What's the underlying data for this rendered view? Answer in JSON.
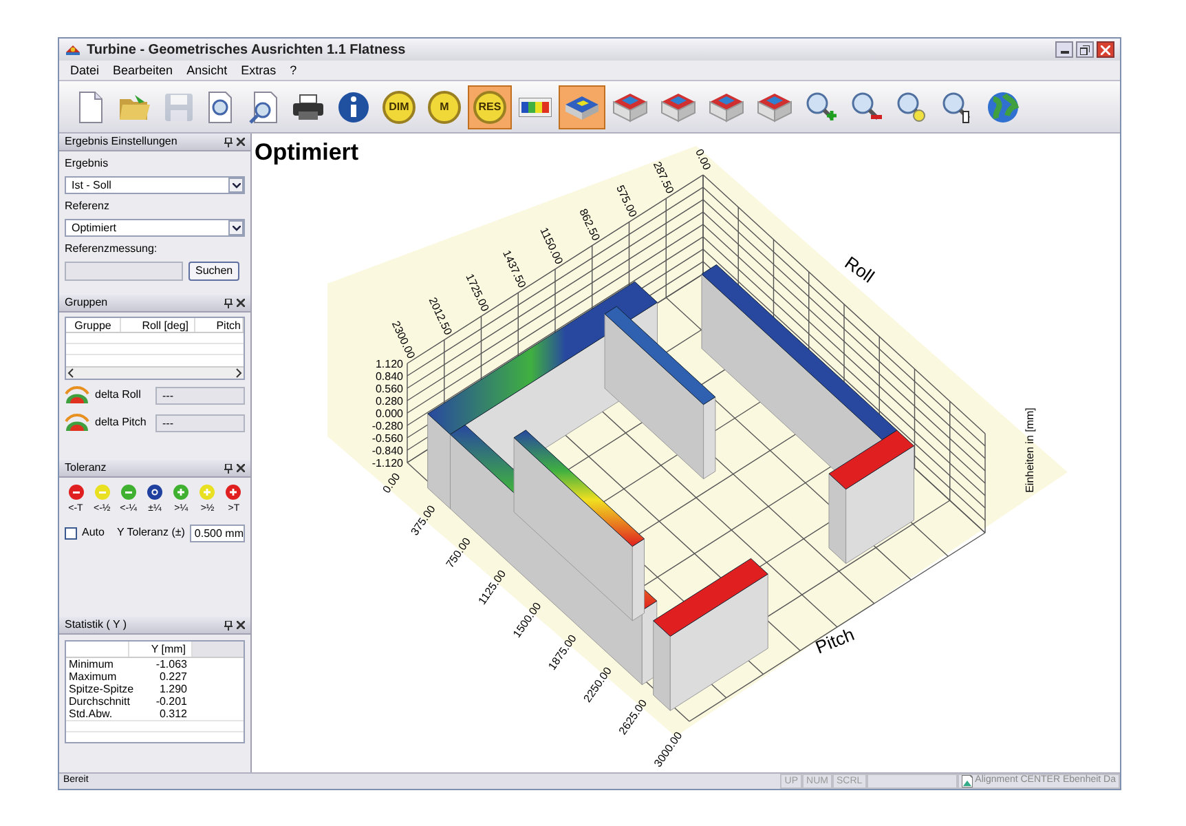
{
  "window": {
    "title": "Turbine - Geometrisches Ausrichten 1.1  Flatness"
  },
  "menu": [
    "Datei",
    "Bearbeiten",
    "Ansicht",
    "Extras",
    "?"
  ],
  "toolbar": [
    {
      "kind": "document",
      "selected": false,
      "disabled": false
    },
    {
      "kind": "folder",
      "selected": false,
      "disabled": false
    },
    {
      "kind": "save",
      "selected": false,
      "disabled": true
    },
    {
      "kind": "preview",
      "selected": false,
      "disabled": false
    },
    {
      "kind": "preview-zoom",
      "selected": false,
      "disabled": false
    },
    {
      "kind": "printer",
      "selected": false,
      "disabled": false
    },
    {
      "kind": "info",
      "selected": false,
      "disabled": false
    },
    {
      "kind": "badge",
      "label": "DIM",
      "selected": false,
      "disabled": false
    },
    {
      "kind": "badge",
      "label": "M",
      "selected": false,
      "disabled": false
    },
    {
      "kind": "badge",
      "label": "RES",
      "selected": true,
      "disabled": false
    },
    {
      "kind": "colorbar",
      "selected": false,
      "disabled": false
    },
    {
      "kind": "view3d",
      "selected": true,
      "disabled": false
    },
    {
      "kind": "box",
      "selected": false,
      "disabled": false
    },
    {
      "kind": "box",
      "selected": false,
      "disabled": false
    },
    {
      "kind": "box",
      "selected": false,
      "disabled": false
    },
    {
      "kind": "box",
      "selected": false,
      "disabled": false
    },
    {
      "kind": "zoom-in",
      "selected": false,
      "disabled": false
    },
    {
      "kind": "zoom-out",
      "selected": false,
      "disabled": false
    },
    {
      "kind": "zoom-fit",
      "selected": false,
      "disabled": false
    },
    {
      "kind": "zoom-hand",
      "selected": false,
      "disabled": false
    },
    {
      "kind": "globe",
      "selected": false,
      "disabled": false
    }
  ],
  "ergebnis_panel": {
    "title": "Ergebnis Einstellungen",
    "ergebnis_label": "Ergebnis",
    "ergebnis_value": "Ist - Soll",
    "referenz_label": "Referenz",
    "referenz_value": "Optimiert",
    "referenzmessung_label": "Referenzmessung:",
    "search_button": "Suchen"
  },
  "gruppen_panel": {
    "title": "Gruppen",
    "columns": [
      "Gruppe",
      "Roll [deg]",
      "Pitch"
    ],
    "deltas": [
      {
        "label": "delta Roll",
        "value": "---"
      },
      {
        "label": "delta Pitch",
        "value": "---"
      }
    ]
  },
  "toleranz_panel": {
    "title": "Toleranz",
    "levels": [
      {
        "kind": "minus",
        "color": "#e02020",
        "label": "<-T"
      },
      {
        "kind": "minus",
        "color": "#e8e020",
        "label": "<-½"
      },
      {
        "kind": "minus",
        "color": "#40b030",
        "label": "<-¼"
      },
      {
        "kind": "zero",
        "color": "#2040a0",
        "label": "±¼"
      },
      {
        "kind": "plus",
        "color": "#40b030",
        "label": ">¼"
      },
      {
        "kind": "plus",
        "color": "#e8e020",
        "label": ">½"
      },
      {
        "kind": "plus",
        "color": "#e02020",
        "label": ">T"
      }
    ],
    "auto_label": "Auto",
    "auto_checked": false,
    "y_tol_label": "Y Toleranz (±)",
    "y_tol_value": "0.500 mm"
  },
  "statistik_panel": {
    "title": "Statistik ( Y )",
    "column": "Y [mm]",
    "rows": [
      {
        "label": "Minimum",
        "value": "-1.063"
      },
      {
        "label": "Maximum",
        "value": "0.227"
      },
      {
        "label": "Spitze-Spitze",
        "value": "1.290"
      },
      {
        "label": "Durchschnitt",
        "value": "-0.201"
      },
      {
        "label": "Std.Abw.",
        "value": "0.312"
      }
    ]
  },
  "plot": {
    "title": "Optimiert",
    "z_ticks": [
      "1.120",
      "0.840",
      "0.560",
      "0.280",
      "0.000",
      "-0.280",
      "-0.560",
      "-0.840",
      "-1.120"
    ],
    "roll_ticks": [
      "2300.00",
      "2012.50",
      "1725.00",
      "1437.50",
      "1150.00",
      "862.50",
      "575.00",
      "287.50",
      "0.00"
    ],
    "pitch_ticks": [
      "0.00",
      "375.00",
      "750.00",
      "1125.00",
      "1500.00",
      "1875.00",
      "2250.00",
      "2625.00",
      "3000.00"
    ],
    "roll_label": "Roll",
    "pitch_label": "Pitch",
    "z_label": "Einheiten in [mm]"
  },
  "status_bar": {
    "text": "Bereit",
    "indicators": [
      "UP",
      "NUM",
      "SCRL"
    ],
    "document": "Alignment CENTER Ebenheit Da"
  }
}
